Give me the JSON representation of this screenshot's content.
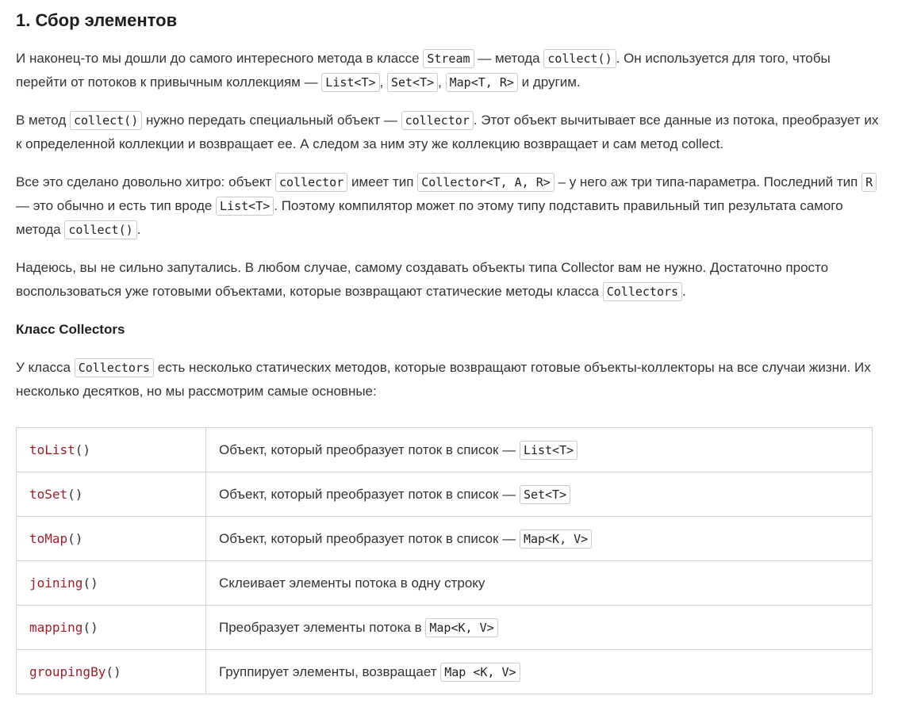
{
  "heading": "1. Сбор элементов",
  "p1": {
    "t1": "И наконец-то мы дошли до самого интересного метода в классе ",
    "c1": "Stream",
    "t2": " — метода ",
    "c2": "collect()",
    "t3": ". Он используется для того, чтобы перейти от потоков к привычным коллекциям — ",
    "c3": "List<T>",
    "t4": ", ",
    "c4": "Set<T>",
    "t5": ", ",
    "c5": "Map<T, R>",
    "t6": " и другим."
  },
  "p2": {
    "t1": "В метод ",
    "c1": "collect()",
    "t2": " нужно передать специальный объект — ",
    "c2": "collector",
    "t3": ". Этот объект вычитывает все данные из потока, преобразует их к определенной коллекции и возвращает ее. А следом за ним эту же коллекцию возвращает и сам метод collect."
  },
  "p3": {
    "t1": "Все это сделано довольно хитро: объект ",
    "c1": "collector",
    "t2": " имеет тип ",
    "c2": "Collector<T, A, R>",
    "t3": " – у него аж три типа-параметра. Последний тип ",
    "c3": "R",
    "t4": " — это обычно и есть тип вроде ",
    "c4": "List<T>",
    "t5": ". Поэтому компилятор может по этому типу подставить правильный тип результата самого метода ",
    "c5": "collect()",
    "t6": "."
  },
  "p4": {
    "t1": "Надеюсь, вы не сильно запутались. В любом случае, самому создавать объекты типа Collector вам не нужно. Достаточно просто воспользоваться уже готовыми объектами, которые возвращают статические методы класса ",
    "c1": "Collectors",
    "t2": "."
  },
  "subheading": "Класс Collectors",
  "p5": {
    "t1": "У класса ",
    "c1": "Collectors",
    "t2": " есть несколько статических методов, которые возвращают готовые объекты-коллекторы на все случаи жизни. Их несколько десятков, но мы рассмотрим самые основные:"
  },
  "table": {
    "rows": [
      {
        "method": "toList",
        "paren": "()",
        "desc": "Объект, который преобразует поток в список — ",
        "code": "List<T>"
      },
      {
        "method": "toSet",
        "paren": "()",
        "desc": "Объект, который преобразует поток в список — ",
        "code": "Set<T>"
      },
      {
        "method": "toMap",
        "paren": "()",
        "desc": "Объект, который преобразует поток в список — ",
        "code": "Map<K, V>"
      },
      {
        "method": "joining",
        "paren": "()",
        "desc": "Склеивает элементы потока в одну строку",
        "code": ""
      },
      {
        "method": "mapping",
        "paren": "()",
        "desc": "Преобразует элементы потока в ",
        "code": "Map<K, V>"
      },
      {
        "method": "groupingBy",
        "paren": "()",
        "desc": "Группирует элементы, возвращает ",
        "code": "Map <K, V>"
      }
    ]
  }
}
